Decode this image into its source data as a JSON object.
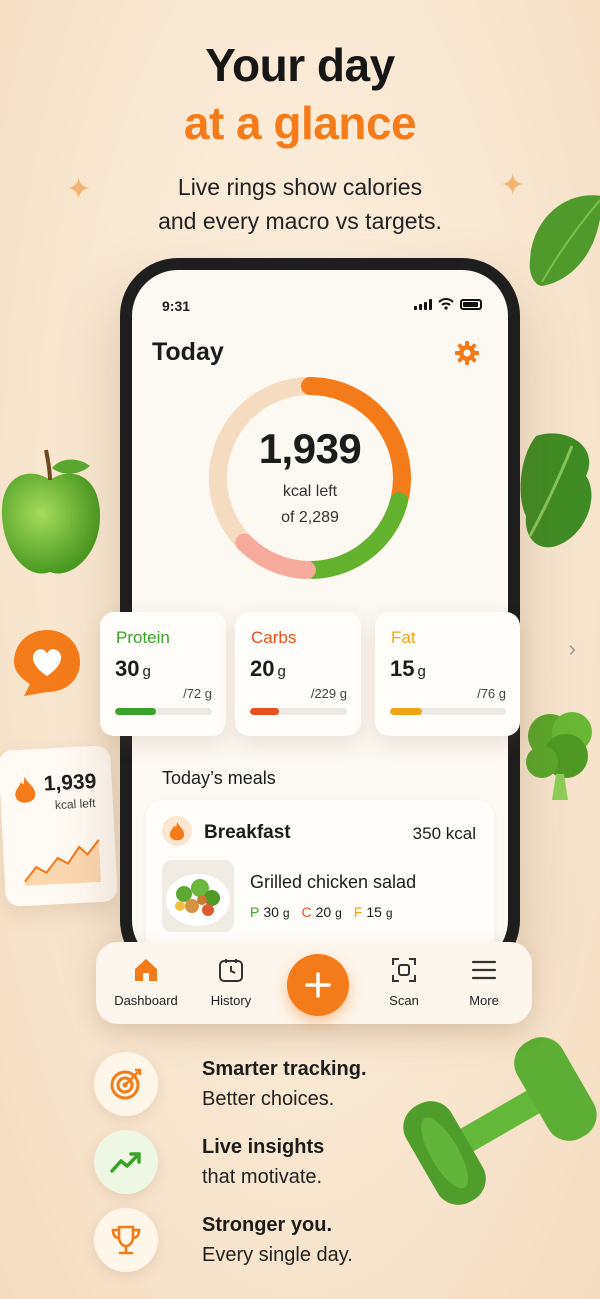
{
  "headline": {
    "line1": "Your day",
    "line2": "at a glance"
  },
  "subtitle": {
    "line1": "Live rings show calories",
    "line2": "and every macro vs targets."
  },
  "colors": {
    "accent": "#f47b1a",
    "protein": "#3aa12b",
    "carbs": "#e8501f",
    "fat": "#f0a316"
  },
  "phone": {
    "status_time": "9:31",
    "title": "Today",
    "settings_icon": "gear-icon",
    "ring": {
      "value": "1,939",
      "line1": "kcal left",
      "line2": "of 2,289",
      "consumed_fraction": 0.153
    }
  },
  "macros": [
    {
      "name": "Protein",
      "value": "30",
      "unit": "g",
      "target": "/72 g",
      "progress": 0.42,
      "color": "#3aa12b"
    },
    {
      "name": "Carbs",
      "value": "20",
      "unit": "g",
      "target": "/229 g",
      "progress": 0.3,
      "color": "#e8501f"
    },
    {
      "name": "Fat",
      "value": "15",
      "unit": "g",
      "target": "/76 g",
      "progress": 0.28,
      "color": "#f0a316"
    }
  ],
  "meals": {
    "title": "Today’s meals",
    "items": [
      {
        "name": "Breakfast",
        "kcal": "350 kcal",
        "food": "Grilled chicken salad",
        "p_label": "P",
        "p_value": "30",
        "p_unit": "g",
        "c_label": "C",
        "c_value": "20",
        "c_unit": "g",
        "f_label": "F",
        "f_value": "15",
        "f_unit": "g"
      }
    ]
  },
  "nav": {
    "dashboard": "Dashboard",
    "history": "History",
    "add": "add-icon",
    "scan": "Scan",
    "more": "More"
  },
  "mini_card": {
    "value": "1,939",
    "label": "kcal left"
  },
  "features": [
    {
      "strong": "Smarter tracking.",
      "light": "Better choices.",
      "icon": "target-icon"
    },
    {
      "strong": "Live insights",
      "light": "that motivate.",
      "icon": "trend-up-icon"
    },
    {
      "strong": "Stronger you.",
      "light": "Every single day.",
      "icon": "trophy-icon"
    }
  ]
}
